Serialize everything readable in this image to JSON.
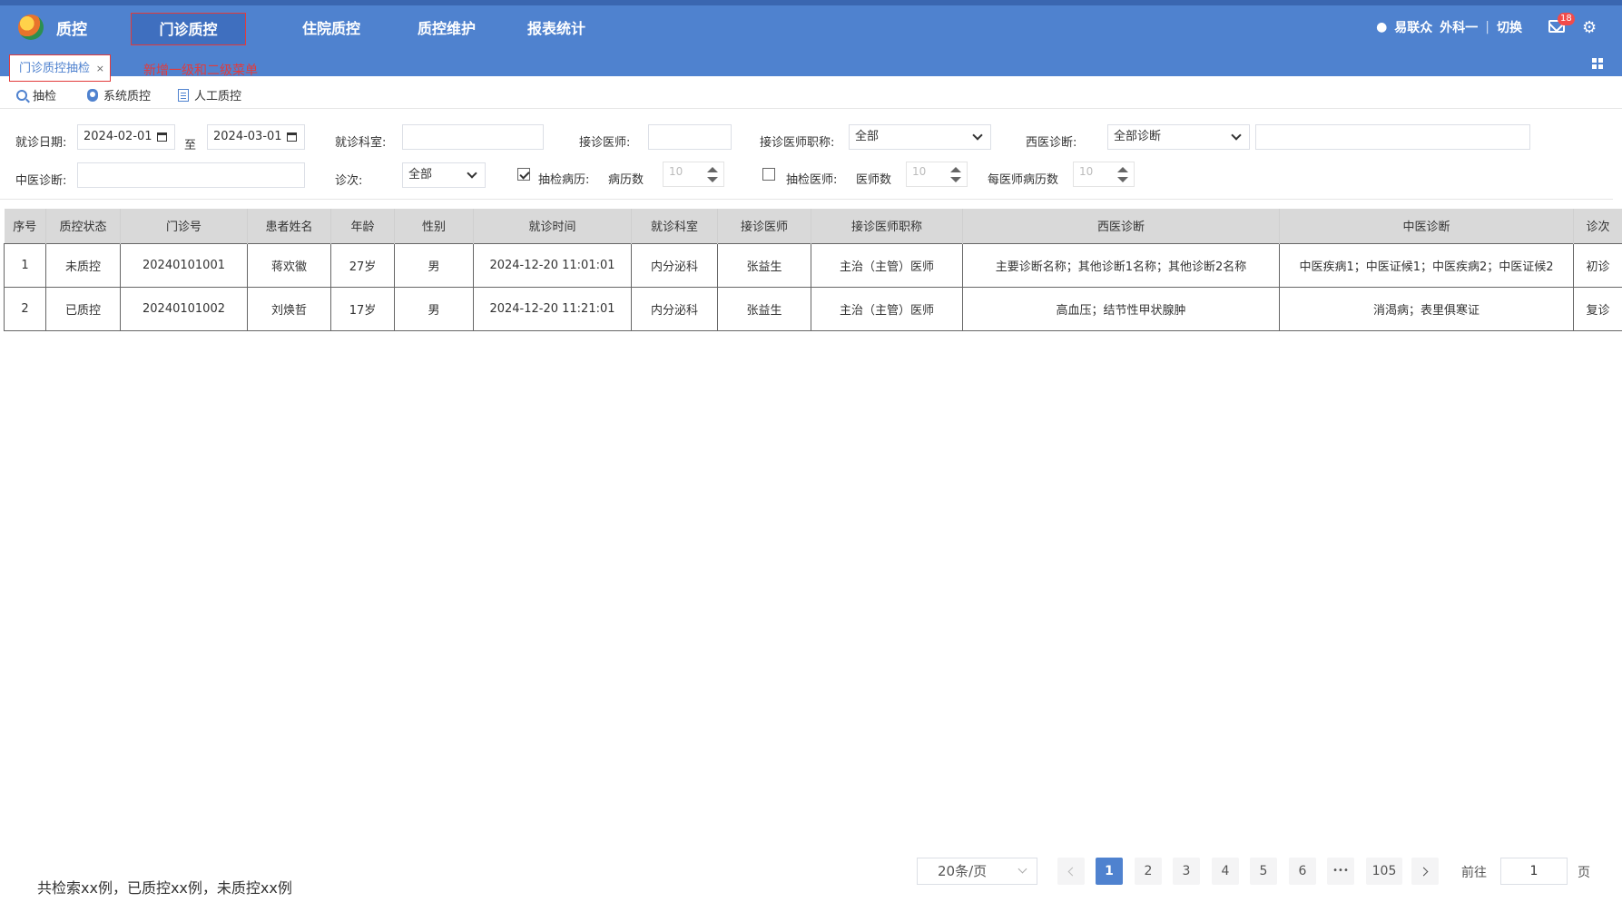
{
  "header": {
    "brand": "质控",
    "nav": [
      "门诊质控",
      "住院质控",
      "质控维护",
      "报表统计"
    ],
    "user": "易联众",
    "dept": "外科一",
    "switch_label": "切换",
    "mail_badge": "18"
  },
  "tabs": {
    "active_tab": "门诊质控抽检",
    "close": "×",
    "note": "新增一级和二级菜单"
  },
  "toolbar": {
    "sample": "抽检",
    "system_qc": "系统质控",
    "manual_qc": "人工质控"
  },
  "filter": {
    "visit_date_label": "就诊日期:",
    "date_from": "2024-02-01",
    "to_label": "至",
    "date_to": "2024-03-01",
    "dept_label": "就诊科室:",
    "doctor_label": "接诊医师:",
    "doctor_title_label": "接诊医师职称:",
    "doctor_title_value": "全部",
    "western_diag_label": "西医诊断:",
    "western_diag_value": "全部诊断",
    "tcm_diag_label": "中医诊断:",
    "visit_count_label": "诊次:",
    "visit_count_value": "全部",
    "sample_records_label": "抽检病历:",
    "record_count_label": "病历数",
    "record_count_value": "10",
    "sample_doctors_label": "抽检医师:",
    "doctor_count_label": "医师数",
    "doctor_count_value": "10",
    "per_doctor_label": "每医师病历数",
    "per_doctor_value": "10"
  },
  "table": {
    "headers": [
      "序号",
      "质控状态",
      "门诊号",
      "患者姓名",
      "年龄",
      "性别",
      "就诊时间",
      "就诊科室",
      "接诊医师",
      "接诊医师职称",
      "西医诊断",
      "中医诊断",
      "诊次"
    ],
    "rows": [
      [
        "1",
        "未质控",
        "20240101001",
        "蒋欢徽",
        "27岁",
        "男",
        "2024-12-20 11:01:01",
        "内分泌科",
        "张益生",
        "主治（主管）医师",
        "主要诊断名称；其他诊断1名称；其他诊断2名称",
        "中医疾病1；中医证候1；中医疾病2；中医证候2",
        "初诊"
      ],
      [
        "2",
        "已质控",
        "20240101002",
        "刘焕哲",
        "17岁",
        "男",
        "2024-12-20 11:21:01",
        "内分泌科",
        "张益生",
        "主治（主管）医师",
        "高血压；结节性甲状腺肿",
        "消渴病；表里俱寒证",
        "复诊"
      ]
    ]
  },
  "footer": {
    "summary": "共检索xx例，已质控xx例，未质控xx例",
    "page_size": "20条/页",
    "pages": [
      "1",
      "2",
      "3",
      "4",
      "5",
      "6"
    ],
    "ellipsis": "•••",
    "last_page": "105",
    "goto_label": "前往",
    "goto_value": "1",
    "page_suffix": "页"
  },
  "colors": {
    "header": "#4f82cf",
    "accent_red": "#e23b3b"
  }
}
